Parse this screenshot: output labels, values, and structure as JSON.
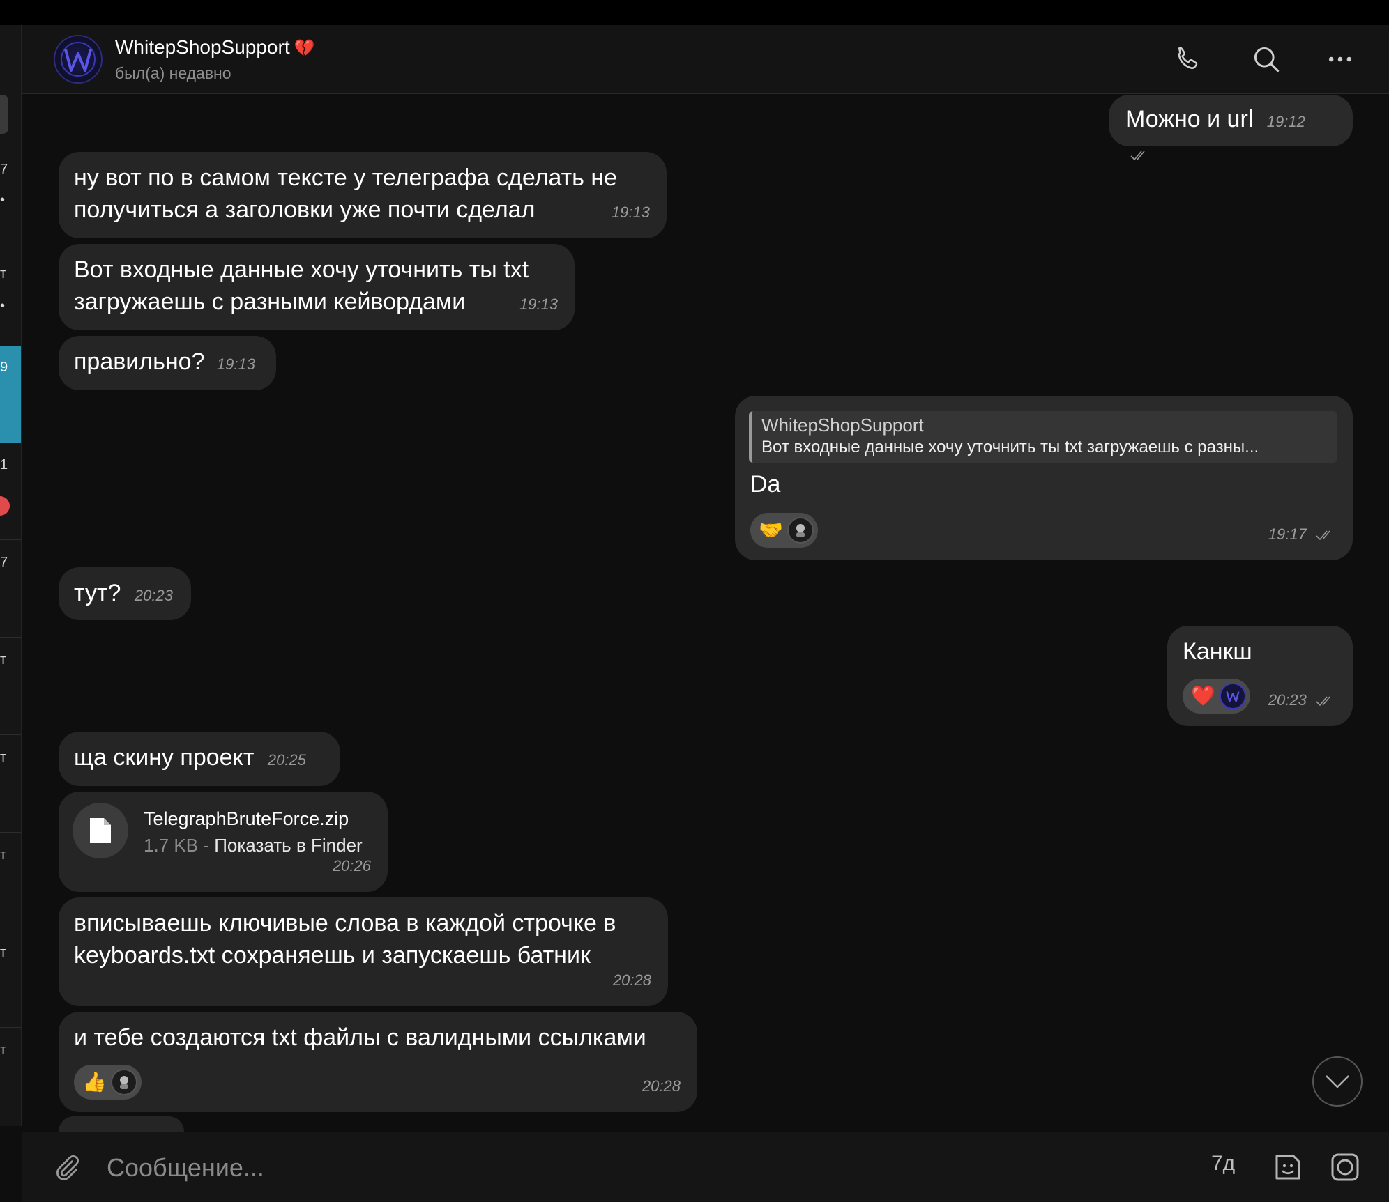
{
  "sidebar": {
    "marks": [
      "7",
      "•",
      "т",
      "•",
      "9",
      "1",
      "7",
      "т",
      "т",
      "т",
      "т",
      "т"
    ]
  },
  "header": {
    "name": "WhitepShopSupport",
    "heart": "💔",
    "status": "был(а) недавно",
    "avatar_letter": "W"
  },
  "messages": {
    "m1": {
      "text": "Можно и url",
      "time": "19:12"
    },
    "m2": {
      "line1": "ну вот по в самом тексте у телеграфа сделать не",
      "line2": "получиться а заголовки уже почти сделал",
      "time": "19:13"
    },
    "m3": {
      "line1": "Вот входные данные хочу уточнить ты txt",
      "line2": "загружаешь с разными кейвордами",
      "time": "19:13"
    },
    "m4": {
      "text": "правильно?",
      "time": "19:13"
    },
    "m5": {
      "reply_name": "WhitepShopSupport",
      "reply_text": "Вот входные данные хочу уточнить ты txt загружаешь с разны...",
      "text": "Da",
      "reaction": "🤝",
      "time": "19:17"
    },
    "m6": {
      "text": "тут?",
      "time": "20:23"
    },
    "m7": {
      "text": "Канкш",
      "reaction": "❤️",
      "time": "20:23"
    },
    "m8": {
      "text": "ща скину проект",
      "time": "20:25"
    },
    "m9": {
      "file_name": "TelegraphBruteForce.zip",
      "file_size": "1.7 KB",
      "separator": "-",
      "finder": "Показать в Finder",
      "time": "20:26"
    },
    "m10": {
      "line1": "вписываешь ключивые слова в каждой строчке в",
      "line2": "keyboards.txt сохраняешь и запускаешь батник",
      "time": "20:28"
    },
    "m11": {
      "text": "и тебе создаются txt файлы с валидными ссылками",
      "reaction": "👍",
      "time": "20:28"
    }
  },
  "composer": {
    "placeholder": "Сообщение...",
    "lang": "7д"
  },
  "colors": {
    "background": "#0e0e0e",
    "bubble_in": "#252525",
    "bubble_out": "#2a2a2a",
    "accent_sidebar": "#2b8fae",
    "time": "#9a9a9a"
  }
}
